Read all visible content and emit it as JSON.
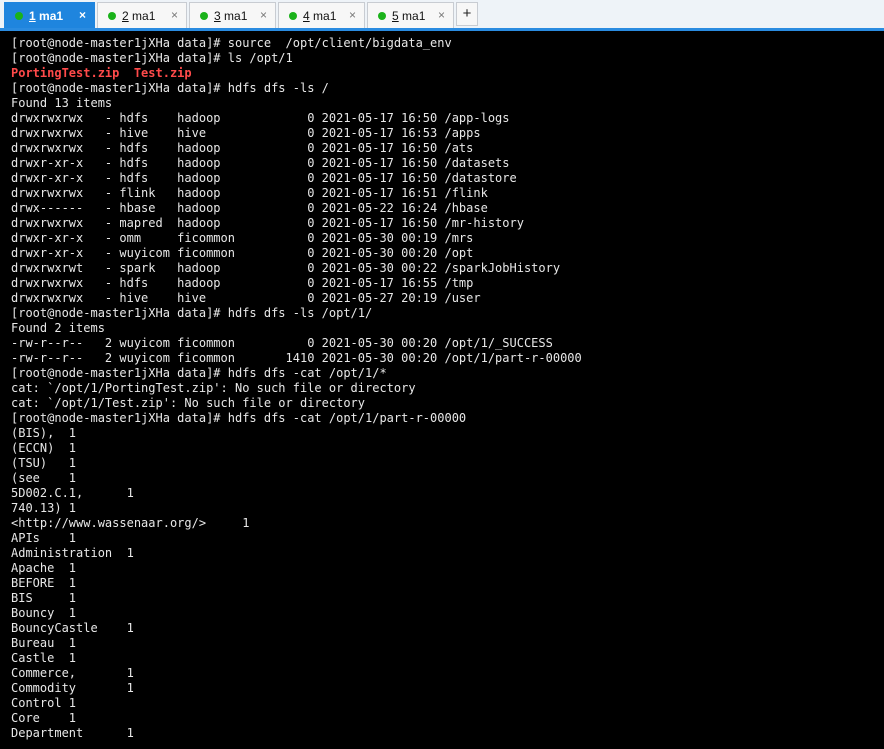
{
  "tabs": [
    {
      "num": "1",
      "name": " ma1",
      "active": true
    },
    {
      "num": "2",
      "name": " ma1",
      "active": false
    },
    {
      "num": "3",
      "name": " ma1",
      "active": false
    },
    {
      "num": "4",
      "name": " ma1",
      "active": false
    },
    {
      "num": "5",
      "name": " ma1",
      "active": false
    }
  ],
  "tab_close_glyph": "×",
  "add_tab_glyph": "+",
  "colors": {
    "accent": "#1f85de",
    "connected_dot": "#1ab21a",
    "terminal_bg": "#000000",
    "terminal_fg": "#e8e8e8",
    "highlight_red": "#ff4a4a"
  },
  "terminal": {
    "lines": [
      "[root@node-master1jXHa data]# source  /opt/client/bigdata_env",
      "[root@node-master1jXHa data]# ls /opt/1",
      "PortingTest.zip  Test.zip",
      "[root@node-master1jXHa data]# hdfs dfs -ls /",
      "Found 13 items",
      "drwxrwxrwx   - hdfs    hadoop            0 2021-05-17 16:50 /app-logs",
      "drwxrwxrwx   - hive    hive              0 2021-05-17 16:53 /apps",
      "drwxrwxrwx   - hdfs    hadoop            0 2021-05-17 16:50 /ats",
      "drwxr-xr-x   - hdfs    hadoop            0 2021-05-17 16:50 /datasets",
      "drwxr-xr-x   - hdfs    hadoop            0 2021-05-17 16:50 /datastore",
      "drwxrwxrwx   - flink   hadoop            0 2021-05-17 16:51 /flink",
      "drwx------   - hbase   hadoop            0 2021-05-22 16:24 /hbase",
      "drwxrwxrwx   - mapred  hadoop            0 2021-05-17 16:50 /mr-history",
      "drwxr-xr-x   - omm     ficommon          0 2021-05-30 00:19 /mrs",
      "drwxr-xr-x   - wuyicom ficommon          0 2021-05-30 00:20 /opt",
      "drwxrwxrwt   - spark   hadoop            0 2021-05-30 00:22 /sparkJobHistory",
      "drwxrwxrwx   - hdfs    hadoop            0 2021-05-17 16:55 /tmp",
      "drwxrwxrwx   - hive    hive              0 2021-05-27 20:19 /user",
      "[root@node-master1jXHa data]# hdfs dfs -ls /opt/1/",
      "Found 2 items",
      "-rw-r--r--   2 wuyicom ficommon          0 2021-05-30 00:20 /opt/1/_SUCCESS",
      "-rw-r--r--   2 wuyicom ficommon       1410 2021-05-30 00:20 /opt/1/part-r-00000",
      "[root@node-master1jXHa data]# hdfs dfs -cat /opt/1/*",
      "cat: `/opt/1/PortingTest.zip': No such file or directory",
      "cat: `/opt/1/Test.zip': No such file or directory",
      "[root@node-master1jXHa data]# hdfs dfs -cat /opt/1/part-r-00000",
      "(BIS),  1",
      "(ECCN)  1",
      "(TSU)   1",
      "(see    1",
      "5D002.C.1,      1",
      "740.13) 1",
      "<http://www.wassenaar.org/>     1",
      "APIs    1",
      "Administration  1",
      "Apache  1",
      "BEFORE  1",
      "BIS     1",
      "Bouncy  1",
      "BouncyCastle    1",
      "Bureau  1",
      "Castle  1",
      "Commerce,       1",
      "Commodity       1",
      "Control 1",
      "Core    1",
      "Department      1"
    ]
  }
}
